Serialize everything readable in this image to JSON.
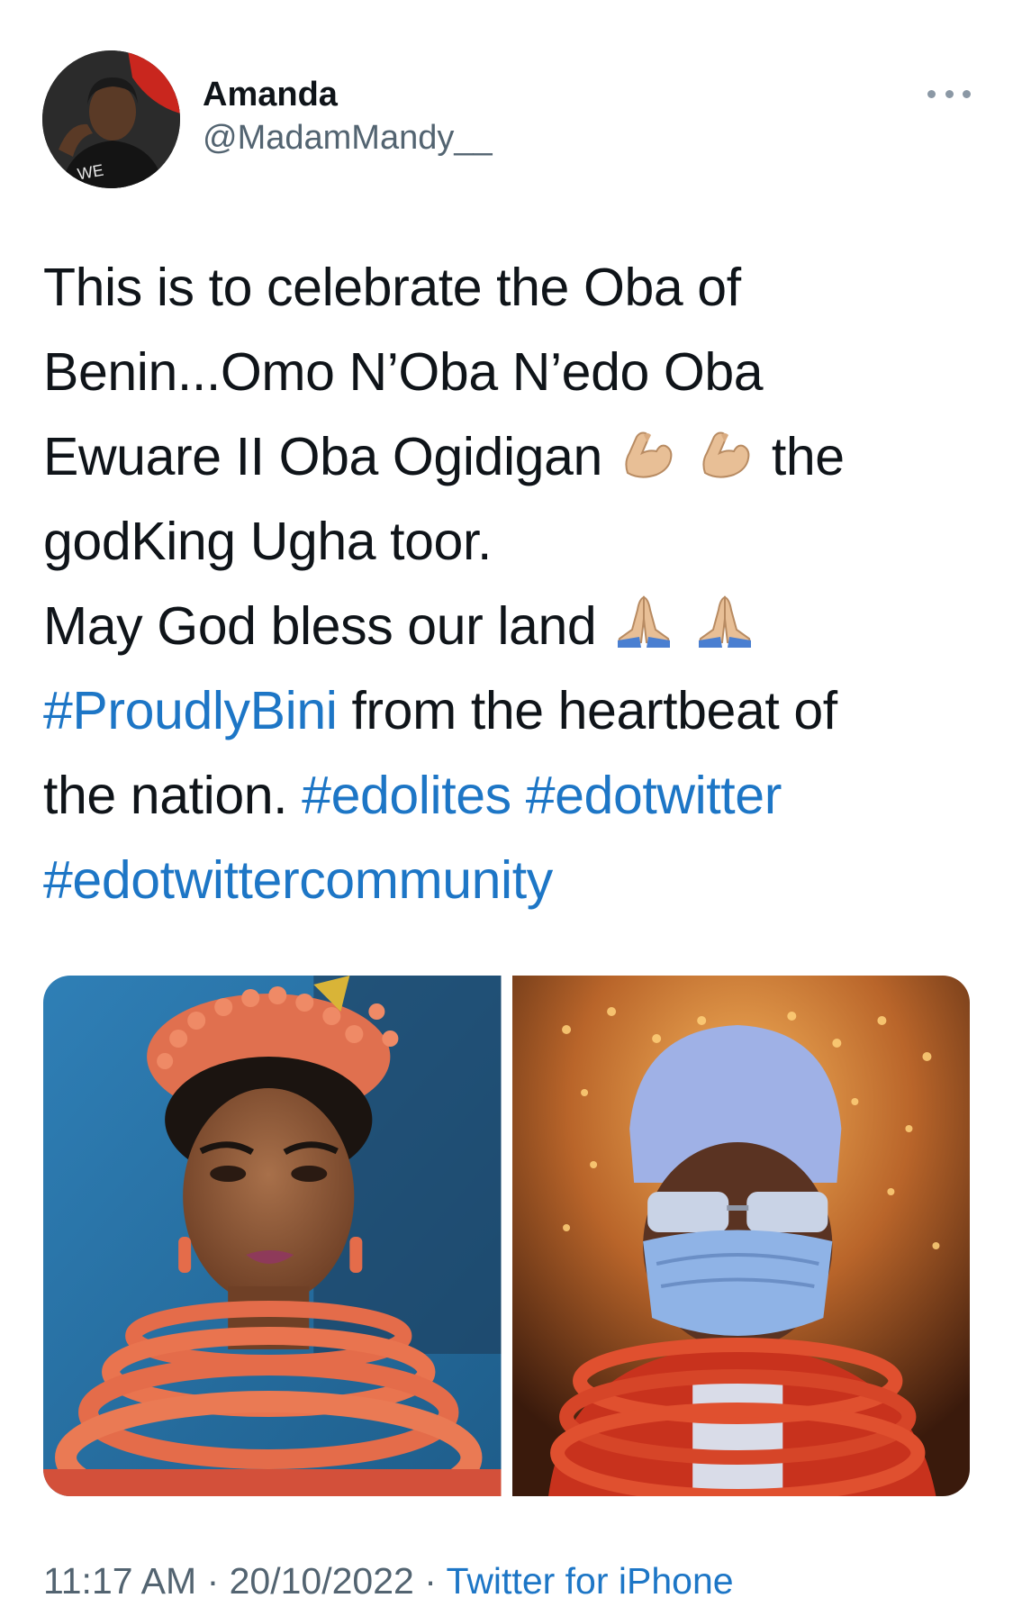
{
  "tweet": {
    "author": {
      "display_name": "Amanda",
      "handle": "@MadamMandy__",
      "avatar_icon": "profile-photo"
    },
    "more_icon": "more-dots-icon",
    "text_lines": [
      "This is to celebrate the Oba of",
      "Benin...Omo N’Oba N’edo Oba",
      "Ewuare II Oba Ogidigan",
      "the",
      "godKing Ugha toor.",
      "May God bless our land"
    ],
    "line7": {
      "hashtag": "#ProudlyBini",
      "rest": " from the heartbeat of"
    },
    "line8": {
      "text": "the nation. ",
      "hashtag1": "#edolites",
      "hashtag2": "#edotwitter"
    },
    "line9": {
      "hashtag": "#edotwittercommunity"
    },
    "emojis": {
      "flexed_biceps": "flexed-biceps-icon",
      "folded_hands": "folded-hands-icon"
    },
    "media": [
      {
        "description_icon": "photo-woman-coral-beads"
      },
      {
        "description_icon": "photo-oba-chandelier"
      }
    ],
    "meta": {
      "time": "11:17 AM",
      "separator": " · ",
      "date": "20/10/2022",
      "source": "Twitter for iPhone"
    }
  },
  "colors": {
    "hashtag": "#1d76c6",
    "text": "#0f1419",
    "secondary": "#536471"
  }
}
